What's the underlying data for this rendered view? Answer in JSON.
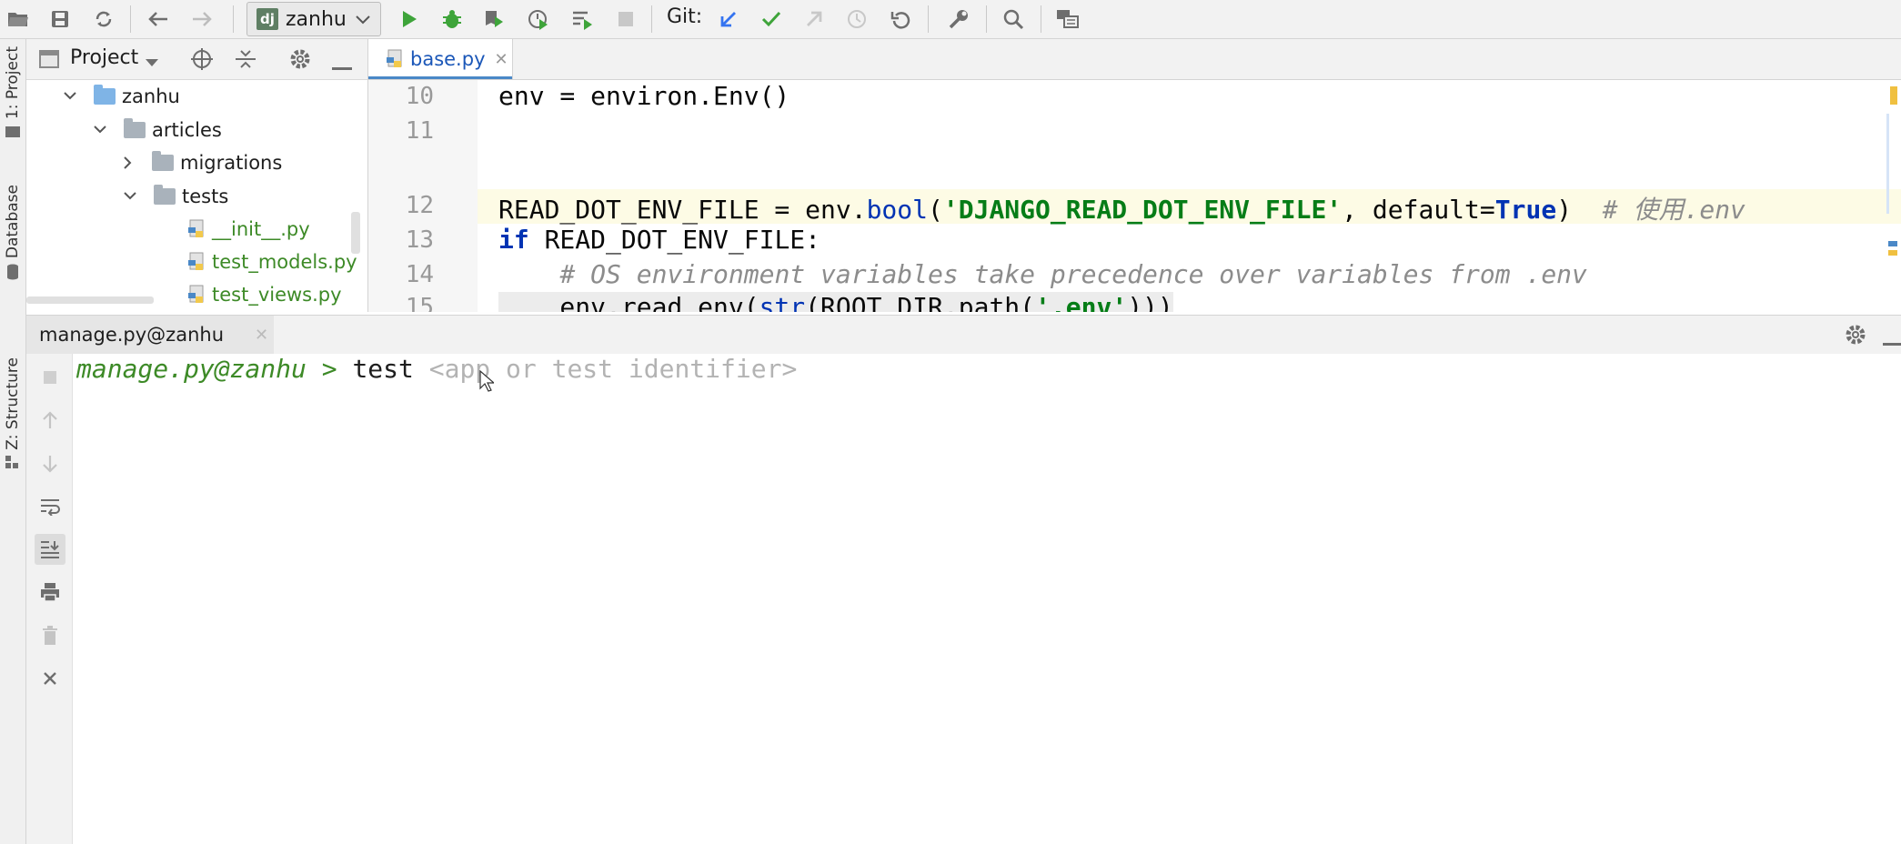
{
  "toolbar": {
    "run_config": "zanhu",
    "run_config_badge": "dj",
    "git_label": "Git:"
  },
  "left_stripe": {
    "tabs": [
      "1: Project",
      "Database",
      "Z: Structure"
    ]
  },
  "project_panel": {
    "title": "Project",
    "tree": [
      {
        "label": "zanhu",
        "kind": "folder-blue",
        "expanded": true,
        "level": 0
      },
      {
        "label": "articles",
        "kind": "folder",
        "expanded": true,
        "level": 1
      },
      {
        "label": "migrations",
        "kind": "folder",
        "expanded": false,
        "level": 2
      },
      {
        "label": "tests",
        "kind": "folder",
        "expanded": true,
        "level": 2
      },
      {
        "label": "__init__.py",
        "kind": "py",
        "level": 3
      },
      {
        "label": "test_models.py",
        "kind": "py",
        "level": 3
      },
      {
        "label": "test_views.py",
        "kind": "py",
        "level": 3
      }
    ]
  },
  "editor": {
    "tab_label": "base.py",
    "lines": [
      {
        "num": "10",
        "text": "env = environ.Env()"
      },
      {
        "num": "11",
        "text": ""
      },
      {
        "num": "12",
        "text": "READ_DOT_ENV_FILE = env.bool('DJANGO_READ_DOT_ENV_FILE', default=True)  # 使用.env"
      },
      {
        "num": "13",
        "text": "if READ_DOT_ENV_FILE:"
      },
      {
        "num": "14",
        "text": "    # OS environment variables take precedence over variables from .env"
      },
      {
        "num": "15",
        "text": "    env.read_env(str(ROOT_DIR.path('.env')))"
      }
    ]
  },
  "console": {
    "tab_label": "manage.py@zanhu",
    "prompt": "manage.py@zanhu > ",
    "command": "test ",
    "hint": "<app or test identifier>"
  },
  "colors": {
    "accent": "#4a88c7",
    "run_green": "#3ea43a",
    "string": "#067d17",
    "keyword": "#0033b3"
  }
}
